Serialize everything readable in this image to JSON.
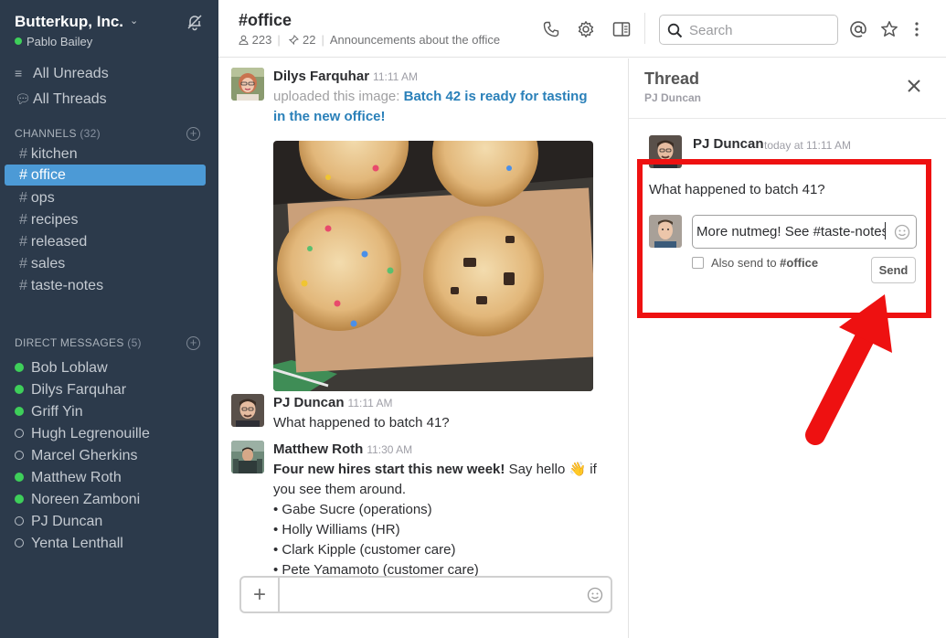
{
  "sidebar": {
    "team_name": "Butterkup, Inc.",
    "user": "Pablo Bailey",
    "nav": [
      {
        "label": "All Unreads",
        "icon": "lines-icon"
      },
      {
        "label": "All Threads",
        "icon": "threads-icon"
      }
    ],
    "channels_heading": "CHANNELS",
    "channels_count": "(32)",
    "channels": [
      "kitchen",
      "office",
      "ops",
      "recipes",
      "released",
      "sales",
      "taste-notes"
    ],
    "active_channel": "office",
    "dm_heading": "DIRECT MESSAGES",
    "dm_count": "(5)",
    "dms": [
      {
        "name": "Bob Loblaw",
        "online": true
      },
      {
        "name": "Dilys Farquhar",
        "online": true
      },
      {
        "name": "Griff Yin",
        "online": true
      },
      {
        "name": "Hugh Legrenouille",
        "online": false
      },
      {
        "name": "Marcel Gherkins",
        "online": false
      },
      {
        "name": "Matthew Roth",
        "online": true
      },
      {
        "name": "Noreen Zamboni",
        "online": true
      },
      {
        "name": "PJ Duncan",
        "online": false
      },
      {
        "name": "Yenta Lenthall",
        "online": false
      }
    ]
  },
  "header": {
    "channel_name": "#office",
    "members": "223",
    "pins": "22",
    "topic": "Announcements about the office",
    "search_placeholder": "Search"
  },
  "messages": [
    {
      "author": "Dilys Farquhar",
      "time": "11:11 AM",
      "uploaded": "uploaded this image:",
      "link": "Batch 42 is ready for tasting in the new office!"
    },
    {
      "author": "PJ Duncan",
      "time": "11:11 AM",
      "text": "What happened to batch 41?"
    },
    {
      "author": "Matthew Roth",
      "time": "11:30 AM",
      "bold": "Four new hires start this new week!",
      "text_a": " Say hello ",
      "emoji": "👋",
      "text_b": " if you see them around.",
      "bullets": [
        "• Gabe Sucre (operations)",
        "• Holly Williams (HR)",
        "• Clark Kipple (customer care)",
        "• Pete Yamamoto (customer care)"
      ]
    }
  ],
  "composer": {
    "value": "",
    "plus": "+"
  },
  "thread": {
    "title": "Thread",
    "subtitle": "PJ Duncan",
    "author": "PJ Duncan",
    "time": "today at 11:11 AM",
    "text": "What happened to batch 41?",
    "reply_value": "More nutmeg! See #taste-notes",
    "also_send_prefix": "Also send to ",
    "also_send_channel": "#office",
    "send_label": "Send"
  },
  "colors": {
    "sidebar_bg": "#2c3a4b",
    "active_channel": "#4c9ad6",
    "online": "#3ecf5a",
    "link": "#2a80b9",
    "highlight": "#ee1111"
  }
}
